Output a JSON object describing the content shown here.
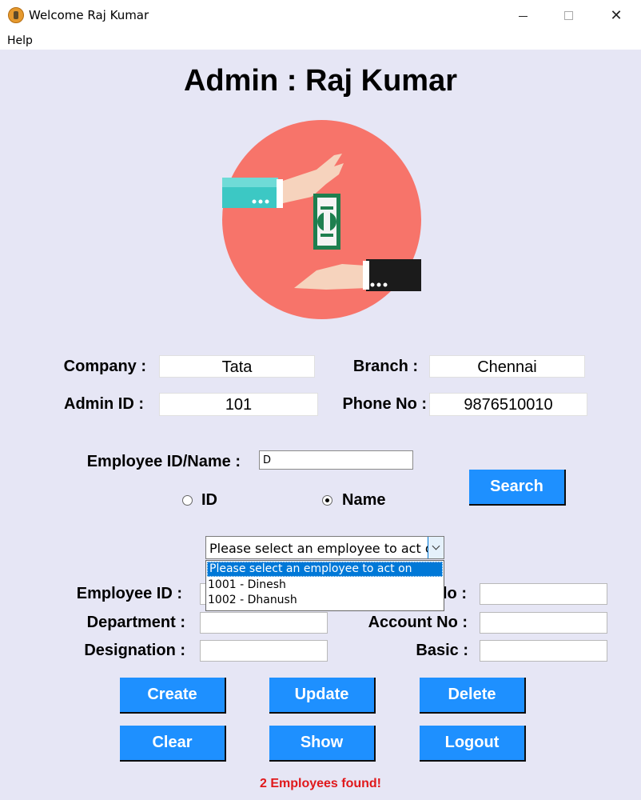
{
  "window": {
    "title": "Welcome Raj Kumar",
    "minimize_label": "",
    "maximize_label": "",
    "close_label": "✕"
  },
  "menu": {
    "help": "Help"
  },
  "header": {
    "title": "Admin : Raj Kumar"
  },
  "admin_info": {
    "company_label": "Company :",
    "company_value": "Tata",
    "branch_label": "Branch :",
    "branch_value": "Chennai",
    "admin_id_label": "Admin ID :",
    "admin_id_value": "101",
    "phone_label": "Phone No :",
    "phone_value": "9876510010"
  },
  "search": {
    "label": "Employee ID/Name :",
    "value": "D",
    "radio_id_label": "ID",
    "radio_name_label": "Name",
    "selected_mode": "Name",
    "button_label": "Search"
  },
  "employee_select": {
    "selected": "Please select an employee to act on",
    "options": [
      "Please select an employee to act on",
      "1001 - Dinesh",
      "1002 - Dhanush"
    ]
  },
  "employee_form": {
    "employee_id_label": "Employee ID :",
    "hidden_label_tail": "lo :",
    "department_label": "Department :",
    "account_no_label": "Account No :",
    "designation_label": "Designation :",
    "basic_label": "Basic :"
  },
  "actions": {
    "create": "Create",
    "update": "Update",
    "delete": "Delete",
    "clear": "Clear",
    "show": "Show",
    "logout": "Logout"
  },
  "status": {
    "message": "2 Employees found!"
  },
  "colors": {
    "background": "#e6e6f5",
    "button": "#1e90ff",
    "status_text": "#e0181b",
    "logo_circle": "#f7746a"
  }
}
